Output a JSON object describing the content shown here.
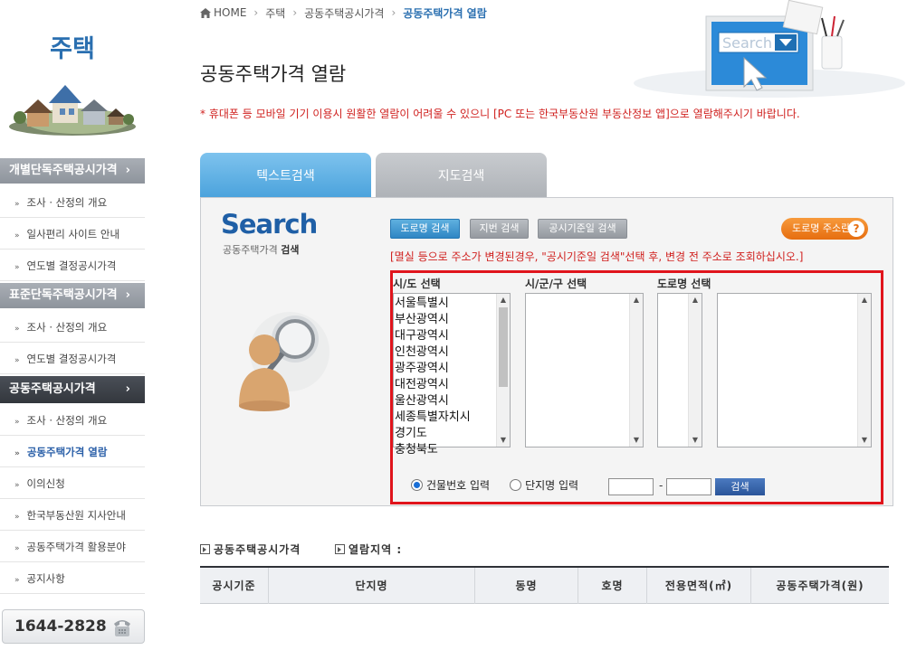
{
  "sidebar": {
    "title": "주택",
    "groups": [
      {
        "label": "개별단독주택공시가격",
        "chevron": "›"
      },
      {
        "label": "표준단독주택공시가격",
        "chevron": "›"
      },
      {
        "label": "공동주택공시가격",
        "chevron": "›"
      }
    ],
    "items": [
      "조사 · 산정의 개요",
      "일사편리 사이트 안내",
      "연도별 결정공시가격",
      "조사 · 산정의 개요",
      "연도별 결정공시가격",
      "조사 · 산정의 개요",
      "공동주택가격 열람",
      "이의신청",
      "한국부동산원 지사안내",
      "공동주택가격 활용분야",
      "공지사항"
    ],
    "bullet": "»",
    "phone": "1644-2828"
  },
  "breadcrumb": {
    "home": "HOME",
    "sep": "›",
    "items": [
      "주택",
      "공동주택공시가격",
      "공동주택가격 열람"
    ]
  },
  "page": {
    "title": "공동주택가격 열람",
    "notice": "* 휴대폰 등 모바일 기기 이용시 원활한 열람이 어려울 수 있으니 [PC 또는 한국부동산원 부동산정보 앱]으로 열람해주시기 바랍니다.",
    "hero_search_word": "Search"
  },
  "tabs": [
    "텍스트검색",
    "지도검색"
  ],
  "search": {
    "logo": "Search",
    "sub_prefix": "공동주택가격 ",
    "sub_bold": "검색",
    "buttons": {
      "road": "도로명 검색",
      "lot": "지번 검색",
      "date": "공시기준일 검색"
    },
    "help_label": "도로명 주소란",
    "help_q": "?",
    "note": "[멸실 등으로 주소가 변경된경우, \"공시기준일 검색\"선택 후, 변경 전 주소로 조회하십시오.]",
    "labels": {
      "sido": "시/도 선택",
      "sigungu": "시/군/구 선택",
      "road": "도로명 선택"
    },
    "sido_options": [
      "서울특별시",
      "부산광역시",
      "대구광역시",
      "인천광역시",
      "광주광역시",
      "대전광역시",
      "울산광역시",
      "세종특별자치시",
      "경기도",
      "충청북도"
    ],
    "radio_building": "건물번호 입력",
    "radio_complex": "단지명 입력",
    "dash": "-",
    "go": "검색"
  },
  "results": {
    "head1": "공동주택공시가격",
    "head2": "열람지역 :",
    "columns": [
      "공시기준",
      "단지명",
      "동명",
      "호명",
      "전용면적(㎡)",
      "공동주택가격(원)"
    ]
  },
  "colors": {
    "accent": "#2a6fb0",
    "alert": "#d0211f",
    "highlight": "#e0141c",
    "help": "#e66d0f"
  }
}
